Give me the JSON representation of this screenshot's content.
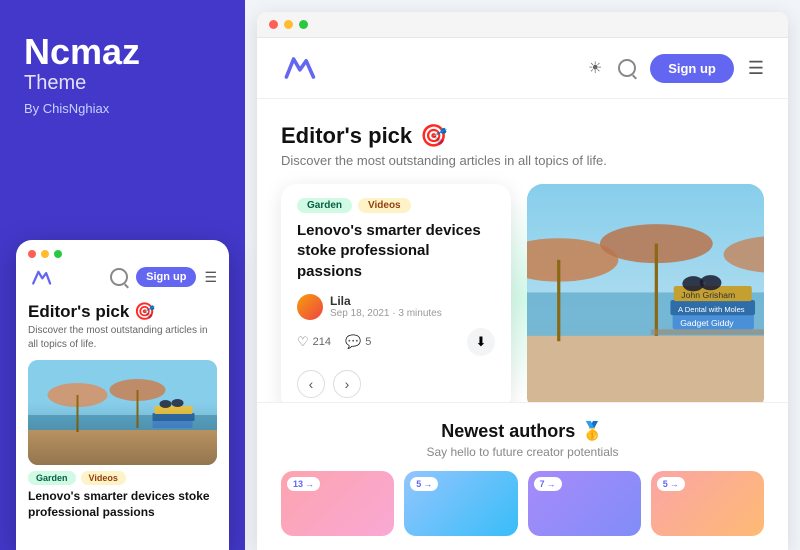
{
  "brand": {
    "title": "Ncmaz",
    "subtitle": "Theme",
    "by": "By ChisNghiax"
  },
  "mobile": {
    "nav": {
      "signup_label": "Sign up"
    },
    "editors_pick": "Editor's pick",
    "editors_pick_emoji": "🎯",
    "desc": "Discover the most outstanding articles in all topics of life.",
    "tags": [
      "Garden",
      "Videos"
    ],
    "article_title": "Lenovo's smarter devices stoke professional passions"
  },
  "site": {
    "nav": {
      "signup_label": "Sign up"
    },
    "editors_pick": "Editor's pick",
    "editors_pick_emoji": "🎯",
    "desc": "Discover the most outstanding articles in all topics of life.",
    "article": {
      "tags": [
        "Garden",
        "Videos"
      ],
      "title": "Lenovo's smarter devices stoke professional passions",
      "author": {
        "name": "Lila",
        "date": "Sep 18, 2021 · 3 minutes"
      },
      "likes": "214",
      "comments": "5"
    },
    "newest": {
      "heading": "Newest authors",
      "emoji": "🥇",
      "sub": "Say hello to future creator potentials",
      "cards": [
        {
          "badge": "13"
        },
        {
          "badge": "5"
        },
        {
          "badge": "7"
        },
        {
          "badge": "5"
        }
      ]
    }
  }
}
